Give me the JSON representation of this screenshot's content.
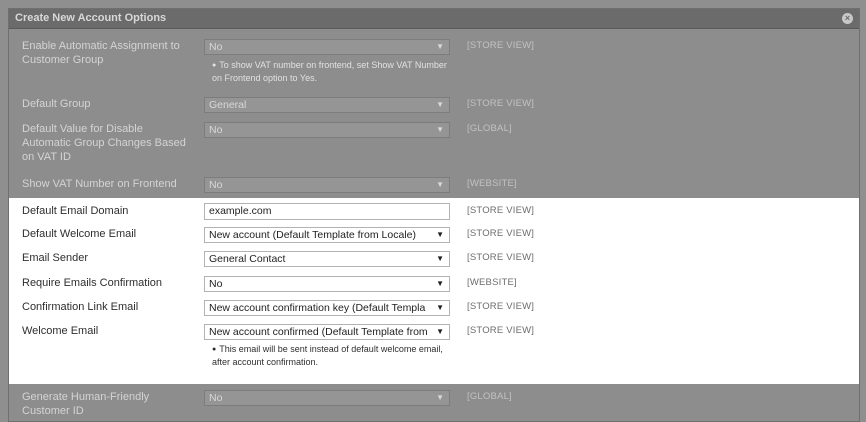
{
  "panel": {
    "title": "Create New Account Options",
    "close_glyph": "×"
  },
  "dim_rows_top": [
    {
      "label": "Enable Automatic Assignment to Customer Group",
      "value": "No",
      "scope": "[STORE VIEW]",
      "note": "To show VAT number on frontend, set Show VAT Number on Frontend option to Yes."
    },
    {
      "label": "Default Group",
      "value": "General",
      "scope": "[STORE VIEW]"
    },
    {
      "label": "Default Value for Disable Automatic Group Changes Based on VAT ID",
      "value": "No",
      "scope": "[GLOBAL]"
    },
    {
      "label": "Show VAT Number on Frontend",
      "value": "No",
      "scope": "[WEBSITE]"
    }
  ],
  "highlighted_rows": [
    {
      "label": "Default Email Domain",
      "value": "example.com",
      "scope": "[STORE VIEW]",
      "type": "text"
    },
    {
      "label": "Default Welcome Email",
      "value": "New account (Default Template from Locale)",
      "scope": "[STORE VIEW]",
      "type": "select"
    },
    {
      "label": "Email Sender",
      "value": "General Contact",
      "scope": "[STORE VIEW]",
      "type": "select"
    },
    {
      "label": "Require Emails Confirmation",
      "value": "No",
      "scope": "[WEBSITE]",
      "type": "select"
    },
    {
      "label": "Confirmation Link Email",
      "value": "New account confirmation key (Default Templa",
      "scope": "[STORE VIEW]",
      "type": "select"
    },
    {
      "label": "Welcome Email",
      "value": "New account confirmed (Default Template from",
      "scope": "[STORE VIEW]",
      "type": "select",
      "note": "This email will be sent instead of default welcome email, after account confirmation."
    }
  ],
  "dim_rows_bottom": [
    {
      "label": "Generate Human-Friendly Customer ID",
      "value": "No",
      "scope": "[GLOBAL]"
    }
  ],
  "icons": {
    "dropdown": "▼",
    "bullet": "●"
  }
}
